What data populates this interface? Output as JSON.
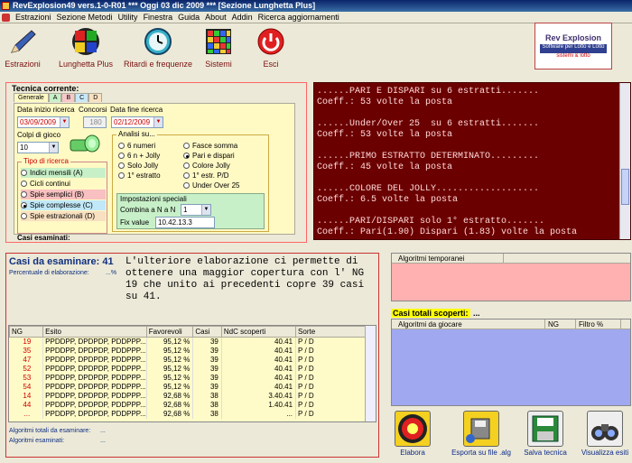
{
  "window": {
    "title": "RevExplosion49 vers.1-0-R01   ***   Oggi 03 dic 2009   ***   [Sezione Lunghetta Plus]"
  },
  "menu": [
    "Estrazioni",
    "Sezione Metodi",
    "Utility",
    "Finestra",
    "Guida",
    "About",
    "Addin",
    "Ricerca aggiornamenti"
  ],
  "toolbar": [
    {
      "label": "Estrazioni",
      "icon": "pencil-icon"
    },
    {
      "label": "Lunghetta Plus",
      "icon": "quadrant-icon"
    },
    {
      "label": "Ritardi e frequenze",
      "icon": "clock-icon"
    },
    {
      "label": "Sistemi",
      "icon": "grid-icon"
    },
    {
      "label": "Esci",
      "icon": "power-icon"
    }
  ],
  "logo": {
    "title": "Rev Explosion",
    "band": "Software per Lotto e Lotto",
    "caption": "sistemi & lotto"
  },
  "tecnica": {
    "title": "Tecnica corrente:",
    "tabs": [
      "Generale",
      "A",
      "B",
      "C",
      "D"
    ],
    "data_inizio_label": "Data inizio ricerca",
    "data_inizio": "03/09/2009",
    "concorsi_label": "Concorsi",
    "concorsi": "180",
    "data_fine_label": "Data fine ricerca",
    "data_fine": "02/12/2009",
    "colpi_label": "Colpi di gioco",
    "colpi": "10",
    "tipo_label": "Tipo di ricerca",
    "tipo_options": [
      "Indici mensili (A)",
      "Cicli continui",
      "Spie semplici (B)",
      "Spie complesse (C)",
      "Spie estrazionali (D)"
    ],
    "analisi_label": "Analisi su...",
    "analisi_col1": [
      "6 numeri",
      "6 n + Jolly",
      "Solo Jolly",
      "1° estratto"
    ],
    "analisi_col2": [
      "Fasce somma",
      "Pari e dispari",
      "Colore Jolly",
      "1° estr. P/D",
      "Under Over 25"
    ],
    "impostazioni_label": "Impostazioni speciali",
    "combina_label": "Combina a N a N",
    "combina": "1",
    "fix_label": "Fix value",
    "fix": "10.42.13.3",
    "casi_esaminati_label": "Casi esaminati:"
  },
  "console": [
    "......PARI E DISPARI su 6 estratti.......",
    "Coeff.: 53 volte la posta",
    "",
    "......Under/Over 25  su 6 estratti.......",
    "Coeff.: 53 volte la posta",
    "",
    "......PRIMO ESTRATTO DETERMINATO.........",
    "Coeff.: 45 volte la posta",
    "",
    "......COLORE DEL JOLLY...................",
    "Coeff.: 6.5 volte la posta",
    "",
    "......PARI/DISPARI solo 1° estratto.......",
    "Coeff.: Pari(1.90) Dispari (1.83) volte la posta"
  ],
  "casi": {
    "title": "Casi da esaminare: 41",
    "percentuale_label": "Percentuale di elaborazione:",
    "percentuale": "...%",
    "note": "L'ulteriore elaborazione ci permette di ottenere una maggior copertura con l' NG 19 che unito ai precedenti copre 39 casi su 41.",
    "columns": [
      "NG",
      "Esito",
      "Favorevoli",
      "Casi",
      "NdC scoperti",
      "Sorte"
    ],
    "rows": [
      [
        "19",
        "PPDDPP, DPDPDP, PDDPPP...",
        "95,12 %",
        "39",
        "40.41",
        "P / D"
      ],
      [
        "35",
        "PPDDPP, DPDPDP, PDDPPP...",
        "95,12 %",
        "39",
        "40.41",
        "P / D"
      ],
      [
        "47",
        "PPDDPP, DPDPDP, PDDPPP...",
        "95,12 %",
        "39",
        "40.41",
        "P / D"
      ],
      [
        "52",
        "PPDDPP, DPDPDP, PDDPPP...",
        "95,12 %",
        "39",
        "40.41",
        "P / D"
      ],
      [
        "53",
        "PPDDPP, DPDPDP, PDDPPP...",
        "95,12 %",
        "39",
        "40.41",
        "P / D"
      ],
      [
        "54",
        "PPDDPP, DPDPDP, PDDPPP...",
        "95,12 %",
        "39",
        "40.41",
        "P / D"
      ],
      [
        "14",
        "PPDDPP, DPDPDP, PDDPPP...",
        "92,68 %",
        "38",
        "3.40.41",
        "P / D"
      ],
      [
        "44",
        "PPDDPP, DPDPDP, PDDPPP...",
        "92,68 %",
        "38",
        "1.40.41",
        "P / D"
      ],
      [
        "...",
        "PPDDPP, DPDPDP, PDDPPP...",
        "92,68 %",
        "38",
        "...",
        "P / D"
      ]
    ],
    "algoritmi_totali_label": "Algoritmi totali da esaminare:",
    "algoritmi_totali": "...",
    "algoritmi_esaminati_label": "Algoritmi esaminati:",
    "algoritmi_esaminati": "..."
  },
  "algoritmi_temporanei": {
    "header": "Algoritmi temporanei"
  },
  "casi_totali": {
    "label": "Casi totali scoperti:",
    "value": "...",
    "columns": [
      "Algoritmi da giocare",
      "NG",
      "Filtro %"
    ]
  },
  "actions": [
    {
      "label": "Elabora",
      "icon": "record-icon"
    },
    {
      "label": "Esporta su file .alg",
      "icon": "export-disk-icon"
    },
    {
      "label": "Salva tecnica",
      "icon": "floppy-icon"
    },
    {
      "label": "Visualizza esiti",
      "icon": "binoculars-icon"
    }
  ],
  "colors": {
    "console_bg": "#6b0000",
    "accent": "#c33333",
    "table_bg": "#fffbc8",
    "pink_panel": "#ffb0b0",
    "blue_panel": "#a0a8f0"
  }
}
